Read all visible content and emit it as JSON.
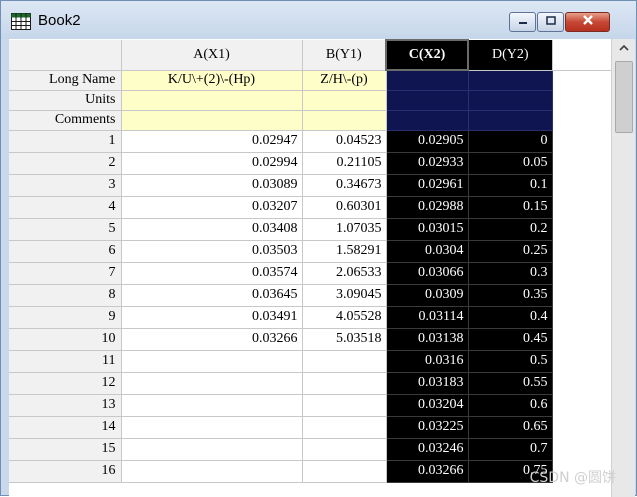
{
  "window": {
    "title": "Book2"
  },
  "columns": [
    {
      "label": "A(X1)",
      "long_name": "K/U\\+(2)\\-(Hp)"
    },
    {
      "label": "B(Y1)",
      "long_name": "Z/H\\-(p)"
    },
    {
      "label": "C(X2)",
      "long_name": ""
    },
    {
      "label": "D(Y2)",
      "long_name": ""
    }
  ],
  "meta_labels": {
    "long_name": "Long Name",
    "units": "Units",
    "comments": "Comments"
  },
  "rows": [
    {
      "n": "1",
      "a": "0.02947",
      "b": "0.04523",
      "c": "0.02905",
      "d": "0"
    },
    {
      "n": "2",
      "a": "0.02994",
      "b": "0.21105",
      "c": "0.02933",
      "d": "0.05"
    },
    {
      "n": "3",
      "a": "0.03089",
      "b": "0.34673",
      "c": "0.02961",
      "d": "0.1"
    },
    {
      "n": "4",
      "a": "0.03207",
      "b": "0.60301",
      "c": "0.02988",
      "d": "0.15"
    },
    {
      "n": "5",
      "a": "0.03408",
      "b": "1.07035",
      "c": "0.03015",
      "d": "0.2"
    },
    {
      "n": "6",
      "a": "0.03503",
      "b": "1.58291",
      "c": "0.0304",
      "d": "0.25"
    },
    {
      "n": "7",
      "a": "0.03574",
      "b": "2.06533",
      "c": "0.03066",
      "d": "0.3"
    },
    {
      "n": "8",
      "a": "0.03645",
      "b": "3.09045",
      "c": "0.0309",
      "d": "0.35"
    },
    {
      "n": "9",
      "a": "0.03491",
      "b": "4.05528",
      "c": "0.03114",
      "d": "0.4"
    },
    {
      "n": "10",
      "a": "0.03266",
      "b": "5.03518",
      "c": "0.03138",
      "d": "0.45"
    },
    {
      "n": "11",
      "a": "",
      "b": "",
      "c": "0.0316",
      "d": "0.5"
    },
    {
      "n": "12",
      "a": "",
      "b": "",
      "c": "0.03183",
      "d": "0.55"
    },
    {
      "n": "13",
      "a": "",
      "b": "",
      "c": "0.03204",
      "d": "0.6"
    },
    {
      "n": "14",
      "a": "",
      "b": "",
      "c": "0.03225",
      "d": "0.65"
    },
    {
      "n": "15",
      "a": "",
      "b": "",
      "c": "0.03246",
      "d": "0.7"
    },
    {
      "n": "16",
      "a": "",
      "b": "",
      "c": "0.03266",
      "d": "0.75"
    }
  ],
  "watermark": "CSDN @圆饼",
  "colors": {
    "selection": "#000000",
    "meta_bg": "#fefec8",
    "selected_meta_bg": "#0f1550"
  },
  "icons": {
    "app": "worksheet-grid-icon",
    "minimize": "minimize-icon",
    "maximize": "maximize-icon",
    "close": "close-icon",
    "scroll_up": "scroll-up-arrow-icon"
  }
}
